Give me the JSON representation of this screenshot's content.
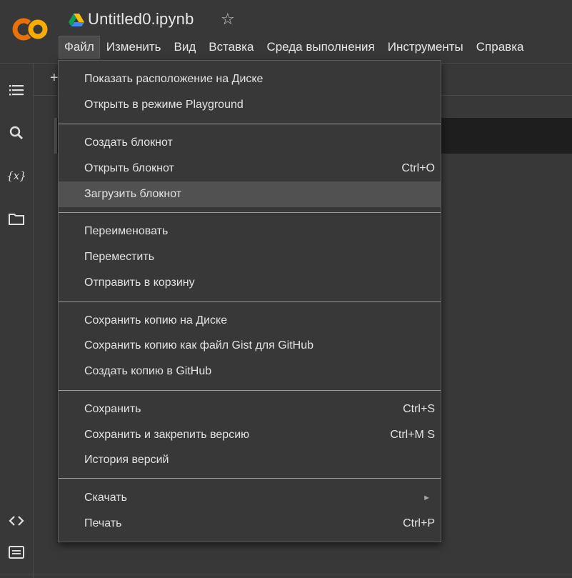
{
  "app": {
    "title": "Untitled0.ipynb",
    "logo_text": "CO",
    "colors": {
      "logo_orange": "#F9AB00",
      "logo_dark_orange": "#E8710A",
      "background": "#383838",
      "menu_hover": "#515151"
    }
  },
  "menubar": {
    "items": [
      {
        "label": "Файл"
      },
      {
        "label": "Изменить"
      },
      {
        "label": "Вид"
      },
      {
        "label": "Вставка"
      },
      {
        "label": "Среда выполнения"
      },
      {
        "label": "Инструменты"
      },
      {
        "label": "Справка"
      }
    ]
  },
  "sidebar": {
    "icons": [
      "table-of-contents-icon",
      "search-icon",
      "variables-icon",
      "folder-icon",
      "code-snippets-icon",
      "terminal-icon"
    ]
  },
  "toolbar": {
    "add_label": "+"
  },
  "file_menu": {
    "groups": [
      [
        {
          "label": "Показать расположение на Диске",
          "shortcut": ""
        },
        {
          "label": "Открыть в режиме Playground",
          "shortcut": ""
        }
      ],
      [
        {
          "label": "Создать блокнот",
          "shortcut": ""
        },
        {
          "label": "Открыть блокнот",
          "shortcut": "Ctrl+O"
        },
        {
          "label": "Загрузить блокнот",
          "shortcut": "",
          "highlighted": true
        }
      ],
      [
        {
          "label": "Переименовать",
          "shortcut": ""
        },
        {
          "label": "Переместить",
          "shortcut": ""
        },
        {
          "label": "Отправить в корзину",
          "shortcut": ""
        }
      ],
      [
        {
          "label": "Сохранить копию на Диске",
          "shortcut": ""
        },
        {
          "label": "Сохранить копию как файл Gist для GitHub",
          "shortcut": ""
        },
        {
          "label": "Создать копию в GitHub",
          "shortcut": ""
        }
      ],
      [
        {
          "label": "Сохранить",
          "shortcut": "Ctrl+S"
        },
        {
          "label": "Сохранить и закрепить версию",
          "shortcut": "Ctrl+M S"
        },
        {
          "label": "История версий",
          "shortcut": ""
        }
      ],
      [
        {
          "label": "Скачать",
          "shortcut": "",
          "submenu": true
        },
        {
          "label": "Печать",
          "shortcut": "Ctrl+P"
        }
      ]
    ]
  }
}
